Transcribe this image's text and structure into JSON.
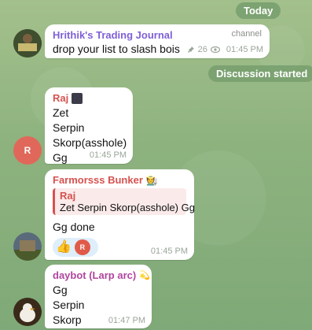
{
  "date_pill": "Today",
  "system_pill": "Discussion started",
  "channel_post": {
    "sender": "Hrithik's Trading Journal",
    "tag": "channel",
    "text": "drop your list to slash bois",
    "views": "26",
    "time": "01:45 PM",
    "sender_color": "#7e5fd6"
  },
  "msg_raj": {
    "sender": "Raj",
    "sender_color": "#d5524f",
    "lines": [
      "Zet",
      "Serpin",
      "Skorp(asshole)",
      "Gg"
    ],
    "time": "01:45 PM",
    "avatar_letter": "R",
    "avatar_color": "#e0685a"
  },
  "msg_farm": {
    "sender": "Farmorsss Bunker",
    "sender_color": "#d5524f",
    "reply_name": "Raj",
    "reply_text": "Zet Serpin Skorp(asshole) Gg",
    "text": "Gg done",
    "reaction_emoji": "👍",
    "reaction_avatar_letter": "R",
    "time": "01:45 PM"
  },
  "msg_daybot": {
    "sender": "daybot (Larp arc)",
    "sender_color": "#b0459e",
    "lines": [
      "Gg",
      "Serpin",
      "Skorp"
    ],
    "time": "01:47 PM"
  },
  "icons": {
    "pin": "pin-icon",
    "views": "eye-icon",
    "raj_badge": "avatar-image-icon",
    "farm_badge": "farmer-emoji-icon",
    "daybot_badge": "sparkle-emoji-icon"
  }
}
